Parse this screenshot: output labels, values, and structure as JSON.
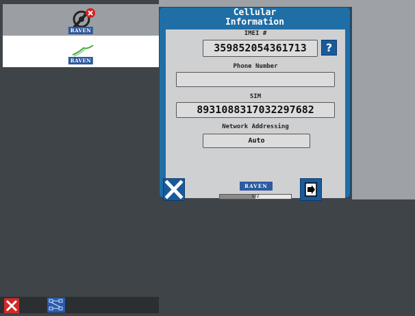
{
  "sidebar": {
    "items": [
      {
        "name": "tools",
        "icon": "wrench-gear-error-icon",
        "brand": "RAVEN"
      },
      {
        "name": "app",
        "icon": "field-track-icon",
        "brand": "RAVEN"
      }
    ]
  },
  "taskbar": {
    "close_icon": "close-icon",
    "network_icon": "network-diagram-icon"
  },
  "dialog": {
    "title_line1": "Cellular",
    "title_line2": "Information",
    "imei_label": "IMEI #",
    "imei_value": "359852054361713",
    "help_label": "?",
    "phone_label": "Phone Number",
    "phone_value": "",
    "sim_label": "SIM",
    "sim_value": "8931088317032297682",
    "network_label": "Network Addressing",
    "network_value": "Auto",
    "brand": "RAVEN",
    "pager_text": "1/2",
    "pager_progress": 0.5
  },
  "colors": {
    "dialog_frame": "#1f6ea6",
    "dialog_body": "#cfd0d2",
    "background": "#3f4448",
    "button": "#1a5a9a",
    "brand": "#2d5aa0"
  }
}
